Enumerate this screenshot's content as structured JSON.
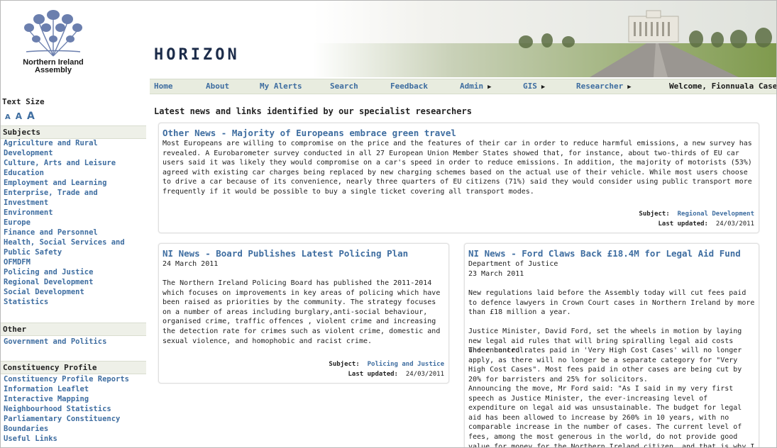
{
  "header": {
    "logo_text_line1": "Northern Ireland",
    "logo_text_line2": "Assembly",
    "site_title": "HORIZON"
  },
  "nav": {
    "items": [
      "Home",
      "About",
      "My Alerts",
      "Search",
      "Feedback"
    ],
    "dropdowns": [
      "Admin",
      "GIS",
      "Researcher"
    ],
    "welcome": "Welcome, Fionnuala Casey"
  },
  "sidebar": {
    "text_size_heading": "Text Size",
    "text_sizes": [
      "A",
      "A",
      "A"
    ],
    "subjects_heading": "Subjects",
    "subjects": [
      "Agriculture and Rural Development",
      "Culture, Arts and Leisure",
      "Education",
      "Employment and Learning",
      "Enterprise, Trade and Investment",
      "Environment",
      "Europe",
      "Finance and Personnel",
      "Health, Social Services and Public Safety",
      "OFMDFM",
      "Policing and Justice",
      "Regional Development",
      "Social Development",
      "Statistics"
    ],
    "other_heading": "Other",
    "other": [
      "Government and Politics"
    ],
    "constituency_heading": "Constituency Profile",
    "constituency": [
      "Constituency Profile Reports",
      "Information Leaflet",
      "Interactive Mapping",
      "Neighbourhood Statistics",
      "Parliamentary Constituency Boundaries",
      "Useful Links"
    ]
  },
  "main": {
    "heading": "Latest news and links identified by our specialist researchers",
    "articles": [
      {
        "title": "Other News - Majority of Europeans embrace green travel",
        "body": "Most Europeans are willing to compromise on the price and the features of their car in order to reduce harmful emissions, a new survey has revealed. A Eurobarometer survey conducted in all 27 European Union Member States showed that, for instance, about two-thirds of EU car users said it was likely they would compromise on a car's speed in order to reduce emissions. In addition, the majority of motorists (53%) agreed with existing car charges being replaced by new charging schemes based on the actual use of their vehicle. While most users choose to drive a car because of its convenience, nearly three quarters of EU citizens (71%) said they would consider using public transport more frequently if it would be possible to buy a single ticket covering all transport modes.",
        "subject_label": "Subject:",
        "subject": "Regional Development",
        "updated_label": "Last updated:",
        "updated": "24/03/2011"
      },
      {
        "title": "NI News - Board Publishes Latest Policing Plan",
        "date": "24 March 2011",
        "body": "The Northern Ireland Policing Board has published the 2011-2014 which focuses on improvements in key areas of policing which have been raised as priorities by the community. The strategy focuses on a number of areas including burglary,anti-social behaviour, organised crime, traffic offences , violent crime and increasing the detection rate for crimes such as violent crime, domestic and sexual violence, and homophobic and racist crime.",
        "subject_label": "Subject:",
        "subject": "Policing and Justice",
        "updated_label": "Last updated:",
        "updated": "24/03/2011"
      },
      {
        "title": "NI News - Ford Claws Back £18.4M for Legal Aid Fund",
        "department": "Department of Justice",
        "date": "23 March 2011",
        "para1": "New regulations laid before the Assembly today will cut fees paid to defence lawyers in Crown Court cases in Northern Ireland by more than £18 million a year.",
        "para2": "Justice Minister, David Ford, set the wheels in motion by laying new legal aid rules that will bring spiralling legal aid costs under control.",
        "para3": "The enhanced rates paid in 'Very High Cost Cases' will no longer apply, as there will no longer be a separate category for \"Very High Cost Cases\". Most fees paid in other cases are being cut by 20% for barristers and 25% for solicitors.",
        "para4": "Announcing the move, Mr Ford said: \"As I said in my very first speech as Justice Minister, the ever-increasing level of expenditure on legal aid was unsustainable. The budget for legal aid has been allowed to increase by 260% in 10 years, with no comparable increase in the number of cases. The current level of fees, among the most generous in the world, do not provide good value for money for the Northern Ireland citizen, and that is why I have made"
      }
    ]
  }
}
